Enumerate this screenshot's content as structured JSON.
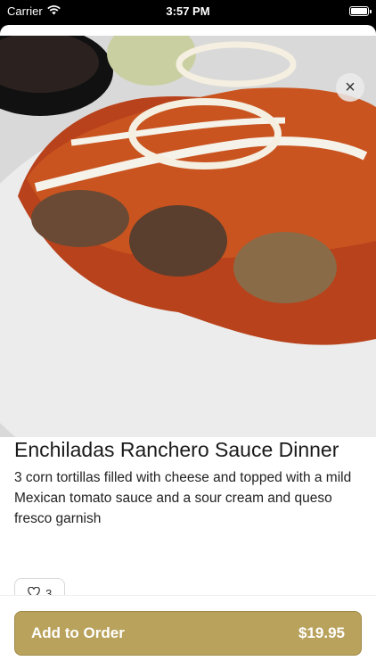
{
  "status": {
    "carrier": "Carrier",
    "time": "3:57 PM"
  },
  "item": {
    "title": "Enchiladas Ranchero Sauce Dinner",
    "description": "3 corn tortillas filled with cheese and topped with a mild Mexican tomato sauce and a sour cream and queso fresco garnish",
    "likes": "3",
    "photo_subject": "enchiladas-with-ranchero-sauce-photo"
  },
  "actions": {
    "close_symbol": "×",
    "add_label": "Add to Order",
    "price": "$19.95"
  },
  "colors": {
    "add_button": "#b9a25c",
    "sauce": "#c0461e"
  }
}
